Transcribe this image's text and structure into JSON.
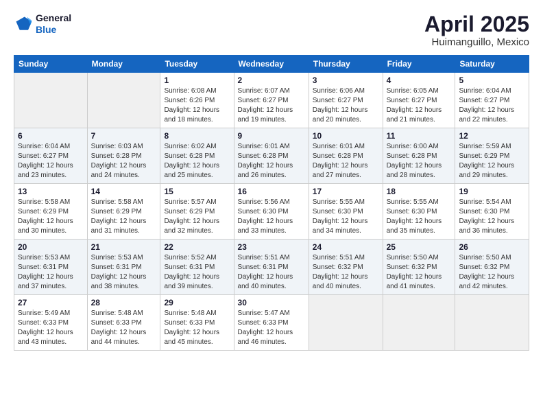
{
  "header": {
    "logo_line1": "General",
    "logo_line2": "Blue",
    "title": "April 2025",
    "subtitle": "Huimanguillo, Mexico"
  },
  "days_of_week": [
    "Sunday",
    "Monday",
    "Tuesday",
    "Wednesday",
    "Thursday",
    "Friday",
    "Saturday"
  ],
  "weeks": [
    [
      {
        "day": "",
        "sunrise": "",
        "sunset": "",
        "daylight": ""
      },
      {
        "day": "",
        "sunrise": "",
        "sunset": "",
        "daylight": ""
      },
      {
        "day": "1",
        "sunrise": "Sunrise: 6:08 AM",
        "sunset": "Sunset: 6:26 PM",
        "daylight": "Daylight: 12 hours and 18 minutes."
      },
      {
        "day": "2",
        "sunrise": "Sunrise: 6:07 AM",
        "sunset": "Sunset: 6:27 PM",
        "daylight": "Daylight: 12 hours and 19 minutes."
      },
      {
        "day": "3",
        "sunrise": "Sunrise: 6:06 AM",
        "sunset": "Sunset: 6:27 PM",
        "daylight": "Daylight: 12 hours and 20 minutes."
      },
      {
        "day": "4",
        "sunrise": "Sunrise: 6:05 AM",
        "sunset": "Sunset: 6:27 PM",
        "daylight": "Daylight: 12 hours and 21 minutes."
      },
      {
        "day": "5",
        "sunrise": "Sunrise: 6:04 AM",
        "sunset": "Sunset: 6:27 PM",
        "daylight": "Daylight: 12 hours and 22 minutes."
      }
    ],
    [
      {
        "day": "6",
        "sunrise": "Sunrise: 6:04 AM",
        "sunset": "Sunset: 6:27 PM",
        "daylight": "Daylight: 12 hours and 23 minutes."
      },
      {
        "day": "7",
        "sunrise": "Sunrise: 6:03 AM",
        "sunset": "Sunset: 6:28 PM",
        "daylight": "Daylight: 12 hours and 24 minutes."
      },
      {
        "day": "8",
        "sunrise": "Sunrise: 6:02 AM",
        "sunset": "Sunset: 6:28 PM",
        "daylight": "Daylight: 12 hours and 25 minutes."
      },
      {
        "day": "9",
        "sunrise": "Sunrise: 6:01 AM",
        "sunset": "Sunset: 6:28 PM",
        "daylight": "Daylight: 12 hours and 26 minutes."
      },
      {
        "day": "10",
        "sunrise": "Sunrise: 6:01 AM",
        "sunset": "Sunset: 6:28 PM",
        "daylight": "Daylight: 12 hours and 27 minutes."
      },
      {
        "day": "11",
        "sunrise": "Sunrise: 6:00 AM",
        "sunset": "Sunset: 6:28 PM",
        "daylight": "Daylight: 12 hours and 28 minutes."
      },
      {
        "day": "12",
        "sunrise": "Sunrise: 5:59 AM",
        "sunset": "Sunset: 6:29 PM",
        "daylight": "Daylight: 12 hours and 29 minutes."
      }
    ],
    [
      {
        "day": "13",
        "sunrise": "Sunrise: 5:58 AM",
        "sunset": "Sunset: 6:29 PM",
        "daylight": "Daylight: 12 hours and 30 minutes."
      },
      {
        "day": "14",
        "sunrise": "Sunrise: 5:58 AM",
        "sunset": "Sunset: 6:29 PM",
        "daylight": "Daylight: 12 hours and 31 minutes."
      },
      {
        "day": "15",
        "sunrise": "Sunrise: 5:57 AM",
        "sunset": "Sunset: 6:29 PM",
        "daylight": "Daylight: 12 hours and 32 minutes."
      },
      {
        "day": "16",
        "sunrise": "Sunrise: 5:56 AM",
        "sunset": "Sunset: 6:30 PM",
        "daylight": "Daylight: 12 hours and 33 minutes."
      },
      {
        "day": "17",
        "sunrise": "Sunrise: 5:55 AM",
        "sunset": "Sunset: 6:30 PM",
        "daylight": "Daylight: 12 hours and 34 minutes."
      },
      {
        "day": "18",
        "sunrise": "Sunrise: 5:55 AM",
        "sunset": "Sunset: 6:30 PM",
        "daylight": "Daylight: 12 hours and 35 minutes."
      },
      {
        "day": "19",
        "sunrise": "Sunrise: 5:54 AM",
        "sunset": "Sunset: 6:30 PM",
        "daylight": "Daylight: 12 hours and 36 minutes."
      }
    ],
    [
      {
        "day": "20",
        "sunrise": "Sunrise: 5:53 AM",
        "sunset": "Sunset: 6:31 PM",
        "daylight": "Daylight: 12 hours and 37 minutes."
      },
      {
        "day": "21",
        "sunrise": "Sunrise: 5:53 AM",
        "sunset": "Sunset: 6:31 PM",
        "daylight": "Daylight: 12 hours and 38 minutes."
      },
      {
        "day": "22",
        "sunrise": "Sunrise: 5:52 AM",
        "sunset": "Sunset: 6:31 PM",
        "daylight": "Daylight: 12 hours and 39 minutes."
      },
      {
        "day": "23",
        "sunrise": "Sunrise: 5:51 AM",
        "sunset": "Sunset: 6:31 PM",
        "daylight": "Daylight: 12 hours and 40 minutes."
      },
      {
        "day": "24",
        "sunrise": "Sunrise: 5:51 AM",
        "sunset": "Sunset: 6:32 PM",
        "daylight": "Daylight: 12 hours and 40 minutes."
      },
      {
        "day": "25",
        "sunrise": "Sunrise: 5:50 AM",
        "sunset": "Sunset: 6:32 PM",
        "daylight": "Daylight: 12 hours and 41 minutes."
      },
      {
        "day": "26",
        "sunrise": "Sunrise: 5:50 AM",
        "sunset": "Sunset: 6:32 PM",
        "daylight": "Daylight: 12 hours and 42 minutes."
      }
    ],
    [
      {
        "day": "27",
        "sunrise": "Sunrise: 5:49 AM",
        "sunset": "Sunset: 6:33 PM",
        "daylight": "Daylight: 12 hours and 43 minutes."
      },
      {
        "day": "28",
        "sunrise": "Sunrise: 5:48 AM",
        "sunset": "Sunset: 6:33 PM",
        "daylight": "Daylight: 12 hours and 44 minutes."
      },
      {
        "day": "29",
        "sunrise": "Sunrise: 5:48 AM",
        "sunset": "Sunset: 6:33 PM",
        "daylight": "Daylight: 12 hours and 45 minutes."
      },
      {
        "day": "30",
        "sunrise": "Sunrise: 5:47 AM",
        "sunset": "Sunset: 6:33 PM",
        "daylight": "Daylight: 12 hours and 46 minutes."
      },
      {
        "day": "",
        "sunrise": "",
        "sunset": "",
        "daylight": ""
      },
      {
        "day": "",
        "sunrise": "",
        "sunset": "",
        "daylight": ""
      },
      {
        "day": "",
        "sunrise": "",
        "sunset": "",
        "daylight": ""
      }
    ]
  ]
}
